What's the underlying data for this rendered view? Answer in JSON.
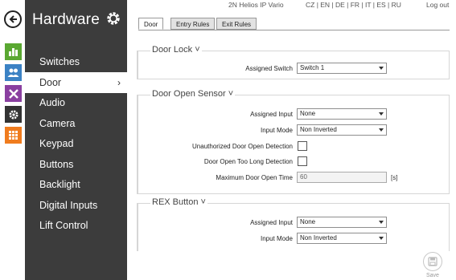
{
  "topbar": {
    "product": "2N Helios IP Vario",
    "languages": "CZ | EN | DE | FR | IT | ES | RU",
    "logout": "Log out"
  },
  "icons": {
    "back": "back-arrow-icon",
    "nav": [
      {
        "name": "status-chart-icon",
        "color": "#5aa832"
      },
      {
        "name": "directory-users-icon",
        "color": "#3b82c4"
      },
      {
        "name": "services-tools-icon",
        "color": "#8a3fa0"
      },
      {
        "name": "hardware-gear-icon",
        "color": "#333333"
      },
      {
        "name": "system-grid-icon",
        "color": "#f07c1e"
      }
    ]
  },
  "sidebar": {
    "title": "Hardware",
    "items": [
      {
        "label": "Switches"
      },
      {
        "label": "Door"
      },
      {
        "label": "Audio"
      },
      {
        "label": "Camera"
      },
      {
        "label": "Keypad"
      },
      {
        "label": "Buttons"
      },
      {
        "label": "Backlight"
      },
      {
        "label": "Digital Inputs"
      },
      {
        "label": "Lift Control"
      }
    ],
    "active_index": 1,
    "active_chevron": "›"
  },
  "tabs": [
    {
      "label": "Door"
    },
    {
      "label": "Entry Rules"
    },
    {
      "label": "Exit Rules"
    }
  ],
  "door_lock": {
    "title": "Door Lock ˅",
    "assigned_switch": {
      "label": "Assigned Switch",
      "value": "Switch 1"
    }
  },
  "door_open_sensor": {
    "title": "Door Open Sensor ˅",
    "assigned_input": {
      "label": "Assigned Input",
      "value": "None"
    },
    "input_mode": {
      "label": "Input Mode",
      "value": "Non Inverted"
    },
    "unauthorized": {
      "label": "Unauthorized Door Open Detection",
      "checked": false
    },
    "too_long": {
      "label": "Door Open Too Long Detection",
      "checked": false
    },
    "max_time": {
      "label": "Maximum Door Open Time",
      "value": "60",
      "unit": "[s]"
    }
  },
  "rex_button": {
    "title": "REX Button ˅",
    "assigned_input": {
      "label": "Assigned Input",
      "value": "None"
    },
    "input_mode": {
      "label": "Input Mode",
      "value": "Non Inverted"
    }
  },
  "save": {
    "label": "Save"
  }
}
